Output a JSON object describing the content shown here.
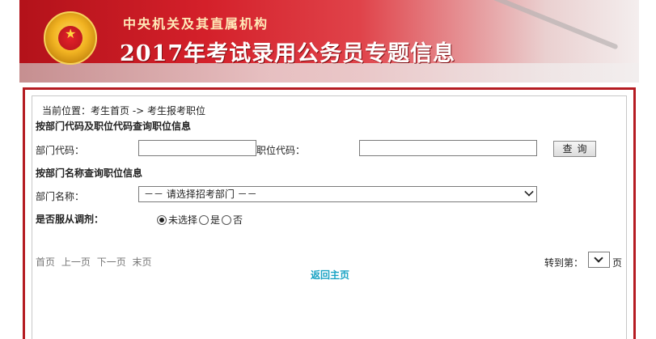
{
  "banner": {
    "subtitle": "中央机关及其直属机构",
    "title": "2017年考试录用公务员专题信息"
  },
  "breadcrumb": {
    "prefix": "当前位置：",
    "home": "考生首页",
    "separator": " -> ",
    "current": "考生报考职位"
  },
  "section_code": {
    "title": "按部门代码及职位代码查询职位信息",
    "dept_code_label": "部门代码：",
    "dept_code_value": "",
    "position_code_label": "职位代码：",
    "position_code_value": "",
    "query_button": "查询"
  },
  "section_name": {
    "title": "按部门名称查询职位信息",
    "dept_name_label": "部门名称：",
    "dept_name_selected": "－－ 请选择招考部门 －－"
  },
  "adjust": {
    "label": "是否服从调剂：",
    "options": [
      {
        "label": "未选择",
        "checked": true
      },
      {
        "label": "是",
        "checked": false
      },
      {
        "label": "否",
        "checked": false
      }
    ]
  },
  "pager": {
    "first": "首页",
    "prev": "上一页",
    "next": "下一页",
    "last": "末页",
    "goto_label": "转到第：",
    "page_value": "",
    "page_unit": "页"
  },
  "return_home": "返回主页",
  "colors": {
    "banner_red": "#d4202a",
    "frame_red": "#b51c22",
    "link_blue": "#1aa3c4"
  }
}
